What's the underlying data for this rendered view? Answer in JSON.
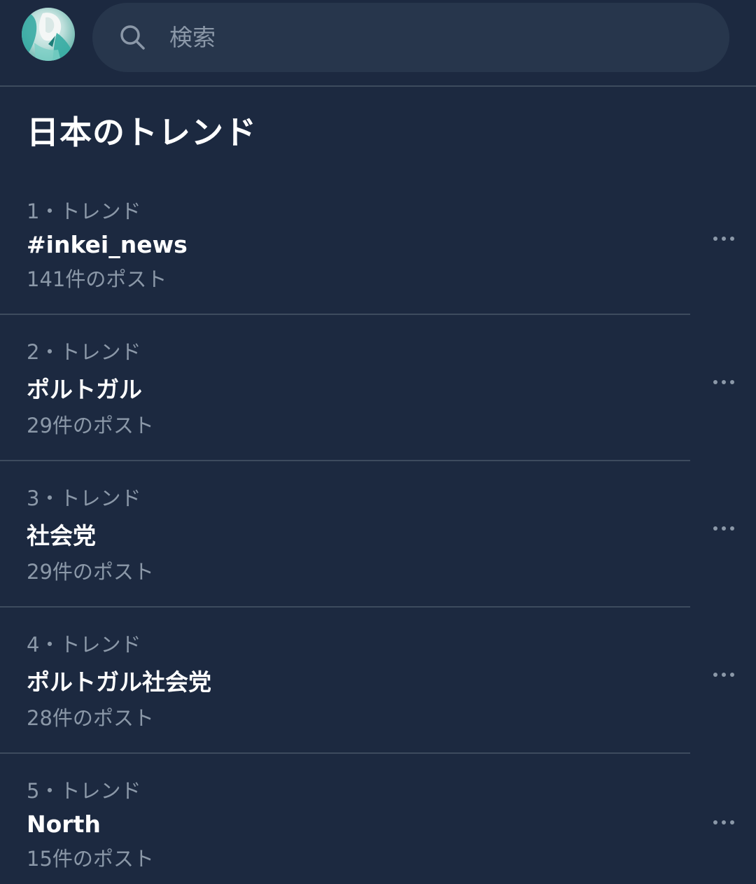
{
  "search": {
    "placeholder": "検索"
  },
  "section": {
    "title": "日本のトレンド"
  },
  "trends": [
    {
      "meta": "1・トレンド",
      "topic": "#inkei_news",
      "count": "141件のポスト"
    },
    {
      "meta": "2・トレンド",
      "topic": "ポルトガル",
      "count": "29件のポスト"
    },
    {
      "meta": "3・トレンド",
      "topic": "社会党",
      "count": "29件のポスト"
    },
    {
      "meta": "4・トレンド",
      "topic": "ポルトガル社会党",
      "count": "28件のポスト"
    },
    {
      "meta": "5・トレンド",
      "topic": "North",
      "count": "15件のポスト"
    }
  ],
  "icons": {
    "search": "search-icon",
    "more": "more-options-icon",
    "avatar": "user-avatar"
  },
  "colors": {
    "background": "#1c2940",
    "search_field": "#27364c",
    "divider": "#3d4b5e",
    "secondary_text": "#8b98a8",
    "primary_text": "#ffffff"
  }
}
